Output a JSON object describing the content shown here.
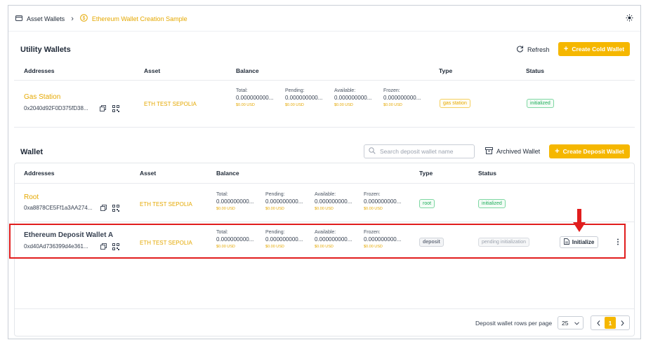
{
  "breadcrumb": {
    "root": "Asset Wallets",
    "separator": "›",
    "current": "Ethereum Wallet Creation Sample"
  },
  "utility": {
    "title": "Utility Wallets",
    "refresh": "Refresh",
    "create_button": "Create Cold Wallet",
    "columns": [
      "Addresses",
      "Asset",
      "Balance",
      "Type",
      "Status"
    ],
    "rows": [
      {
        "name": "Gas Station",
        "address": "0x2040d92F0D375fD38...",
        "asset": "ETH TEST SEPOLIA",
        "balances": [
          {
            "label": "Total:",
            "value": "0.000000000...",
            "usd": "$0.00 USD"
          },
          {
            "label": "Pending:",
            "value": "0.000000000...",
            "usd": "$0.00 USD"
          },
          {
            "label": "Available:",
            "value": "0.000000000...",
            "usd": "$0.00 USD"
          },
          {
            "label": "Frozen:",
            "value": "0.000000000...",
            "usd": "$0.00 USD"
          }
        ],
        "type": "gas station",
        "status": "initialized"
      }
    ]
  },
  "wallet": {
    "title": "Wallet",
    "search_placeholder": "Search deposit wallet name",
    "archived": "Archived Wallet",
    "create_button": "Create Deposit Wallet",
    "columns": [
      "Addresses",
      "Asset",
      "Balance",
      "Type",
      "Status"
    ],
    "rows": [
      {
        "name": "Root",
        "address": "0xa8878CE5Ff1a3AA274...",
        "asset": "ETH TEST SEPOLIA",
        "balances": [
          {
            "label": "Total:",
            "value": "0.000000000...",
            "usd": "$0.00 USD"
          },
          {
            "label": "Pending:",
            "value": "0.000000000...",
            "usd": "$0.00 USD"
          },
          {
            "label": "Available:",
            "value": "0.000000000...",
            "usd": "$0.00 USD"
          },
          {
            "label": "Frozen:",
            "value": "0.000000000...",
            "usd": "$0.00 USD"
          }
        ],
        "type": "root",
        "status": "initialized"
      },
      {
        "name": "Ethereum Deposit Wallet A",
        "address": "0xd40Ad736399d4e361...",
        "asset": "ETH TEST SEPOLIA",
        "balances": [
          {
            "label": "Total:",
            "value": "0.000000000...",
            "usd": "$0.00 USD"
          },
          {
            "label": "Pending:",
            "value": "0.000000000...",
            "usd": "$0.00 USD"
          },
          {
            "label": "Available:",
            "value": "0.000000000...",
            "usd": "$0.00 USD"
          },
          {
            "label": "Frozen:",
            "value": "0.000000000...",
            "usd": "$0.00 USD"
          }
        ],
        "type": "deposit",
        "status": "pending initialization",
        "action": "Initialize"
      }
    ],
    "pagination": {
      "rows_label": "Deposit wallet rows per page",
      "rows_per_page": "25",
      "current_page": "1"
    }
  },
  "colors": {
    "accent": "#f5b700",
    "highlight": "#e11d1d",
    "success": "#1fae5b"
  }
}
